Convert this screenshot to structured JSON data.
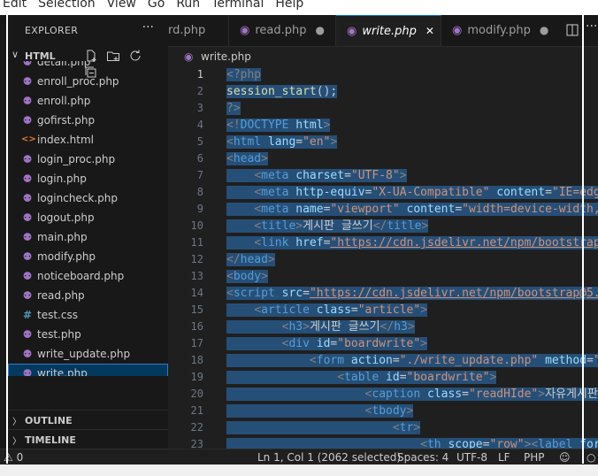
{
  "menu": [
    "Edit",
    "Selection",
    "View",
    "Go",
    "Run",
    "Terminal",
    "Help"
  ],
  "sidebar": {
    "title": "EXPLORER",
    "folder": "HTML",
    "files": [
      {
        "name": "detail.php",
        "icon": "php-file-icon",
        "glyph": " "
      },
      {
        "name": "enroll_proc.php",
        "icon": "php-file-icon"
      },
      {
        "name": "enroll.php",
        "icon": "php-file-icon"
      },
      {
        "name": "gofirst.php",
        "icon": "php-file-icon"
      },
      {
        "name": "index.html",
        "icon": "html-file-icon"
      },
      {
        "name": "login_proc.php",
        "icon": "php-file-icon"
      },
      {
        "name": "login.php",
        "icon": "php-file-icon"
      },
      {
        "name": "logincheck.php",
        "icon": "php-file-icon"
      },
      {
        "name": "logout.php",
        "icon": "php-file-icon"
      },
      {
        "name": "main.php",
        "icon": "php-file-icon"
      },
      {
        "name": "modify.php",
        "icon": "php-file-icon"
      },
      {
        "name": "noticeboard.php",
        "icon": "php-file-icon"
      },
      {
        "name": "read.php",
        "icon": "php-file-icon"
      },
      {
        "name": "test.css",
        "icon": "css-file-icon"
      },
      {
        "name": "test.php",
        "icon": "php-file-icon"
      },
      {
        "name": "write_update.php",
        "icon": "php-file-icon"
      },
      {
        "name": "write.php",
        "icon": "php-file-icon",
        "selected": true
      }
    ],
    "sections": [
      "OUTLINE",
      "TIMELINE"
    ]
  },
  "tabs": [
    {
      "label": "rd.php",
      "state": "plain"
    },
    {
      "label": "read.php",
      "state": "dirty"
    },
    {
      "label": "write.php",
      "state": "active"
    },
    {
      "label": "modify.php",
      "state": "dirty"
    }
  ],
  "breadcrumb": "write.php",
  "editor": {
    "line_numbers": [
      "1",
      "2",
      "3",
      "4",
      "5",
      "6",
      "7",
      "8",
      "9",
      "10",
      "11",
      "12",
      "13",
      "14",
      "15",
      "16",
      "17",
      "18",
      "19",
      "20",
      "21",
      "22",
      "23"
    ],
    "current_line": "1"
  },
  "status": {
    "problems": "0",
    "position": "Ln 1, Col 1 (2062 selected)",
    "spaces": "Spaces: 4",
    "encoding": "UTF-8",
    "eol": "LF",
    "language": "PHP"
  },
  "colors": {
    "selection": "#264f78",
    "tag": "#569cd6",
    "attribute": "#9cdcfe",
    "string": "#ce9178",
    "php_icon": "#a074c4",
    "accent": "#0078d4"
  }
}
